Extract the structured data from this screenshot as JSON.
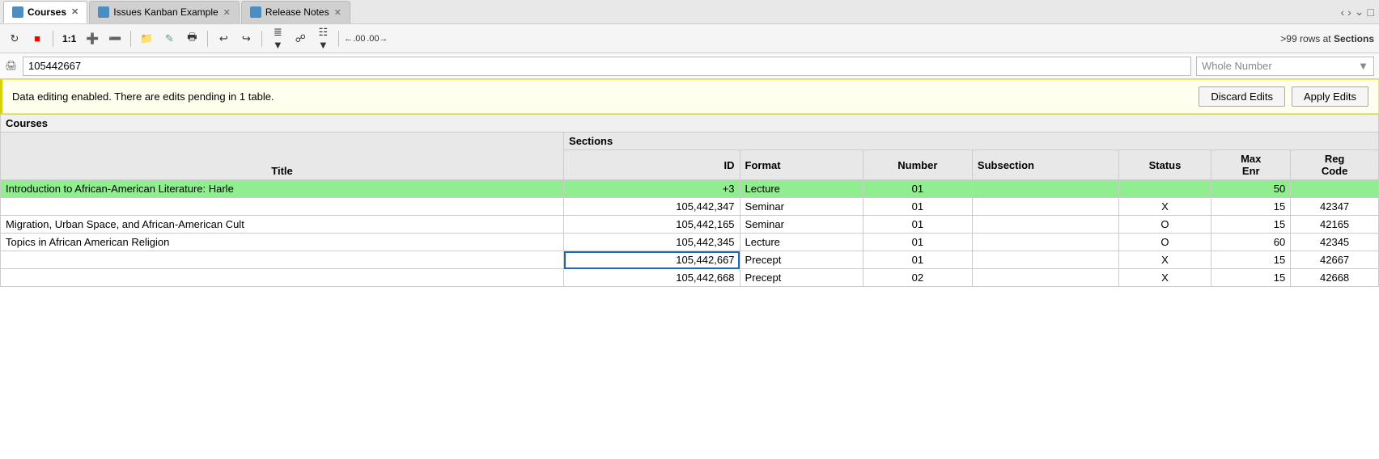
{
  "tabs": [
    {
      "label": "Courses",
      "active": true,
      "icon": "table-icon"
    },
    {
      "label": "Issues Kanban Example",
      "active": false,
      "icon": "table-icon"
    },
    {
      "label": "Release Notes",
      "active": false,
      "icon": "table-icon"
    }
  ],
  "toolbar": {
    "rows_info": ">99 rows at",
    "rows_bold": "Sections"
  },
  "field_bar": {
    "value": "105442667",
    "type_label": "Whole Number"
  },
  "notification": {
    "message": "Data editing enabled. There are edits pending in 1 table.",
    "discard_label": "Discard Edits",
    "apply_label": "Apply Edits"
  },
  "table": {
    "group_header": "Courses",
    "col_title": "Title",
    "sections_header": "Sections",
    "columns": [
      "ID",
      "Format",
      "Number",
      "Subsection",
      "Status",
      "Max\nEnr",
      "Reg\nCode"
    ],
    "rows": [
      {
        "title": "Introduction to African-American Literature: Harle",
        "cells": [
          "+3",
          "Lecture",
          "01",
          "",
          "",
          "50",
          ""
        ],
        "green": true
      },
      {
        "title": "",
        "cells": [
          "105,442,347",
          "Seminar",
          "01",
          "",
          "X",
          "15",
          "42347"
        ],
        "green": false
      },
      {
        "title": "Migration, Urban Space, and African-American Cult",
        "cells": [
          "105,442,165",
          "Seminar",
          "01",
          "",
          "O",
          "15",
          "42165"
        ],
        "green": false
      },
      {
        "title": "Topics in African American Religion",
        "cells": [
          "105,442,345",
          "Lecture",
          "01",
          "",
          "O",
          "60",
          "42345"
        ],
        "green": false
      },
      {
        "title": "",
        "cells": [
          "105,442,667",
          "Precept",
          "01",
          "",
          "X",
          "15",
          "42667"
        ],
        "green": false,
        "selected_id": true
      },
      {
        "title": "",
        "cells": [
          "105,442,668",
          "Precept",
          "02",
          "",
          "X",
          "15",
          "42668"
        ],
        "green": false,
        "partial": true
      }
    ]
  }
}
